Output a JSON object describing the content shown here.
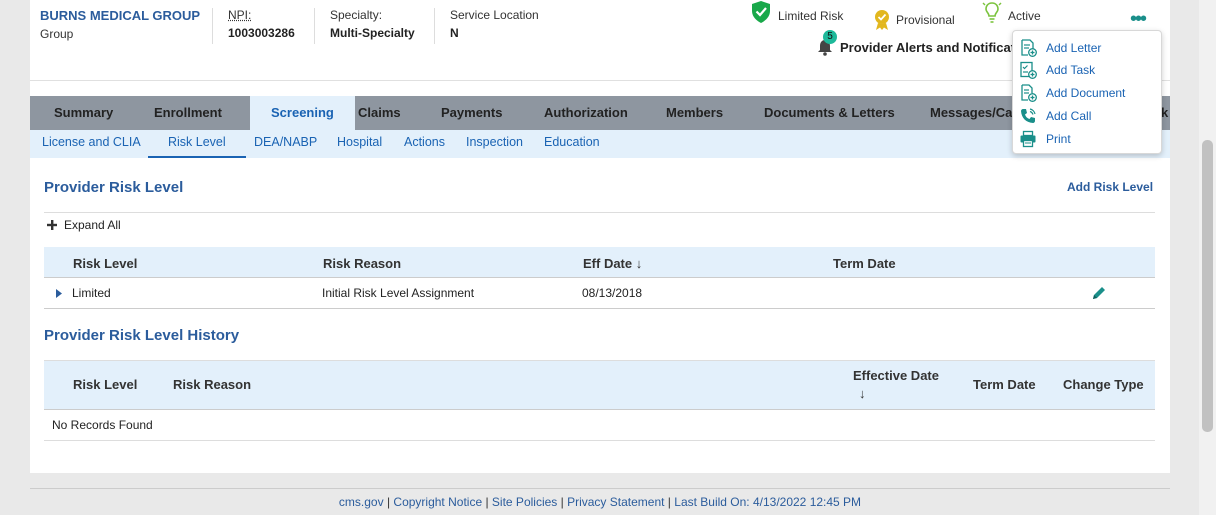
{
  "header": {
    "provider_name": "BURNS MEDICAL GROUP",
    "provider_type": "Group",
    "npi_label": "NPI:",
    "npi_value": "1003003286",
    "specialty_label": "Specialty:",
    "specialty_value": "Multi-Specialty",
    "service_location_label": "Service Location",
    "service_location_value": "N",
    "status_limited_risk": "Limited Risk",
    "status_provisional": "Provisional",
    "status_active": "Active",
    "alerts_count": "5",
    "alerts_label": "Provider Alerts and Notifications",
    "more_label": "•••"
  },
  "tabs": [
    {
      "label": "Summary"
    },
    {
      "label": "Enrollment"
    },
    {
      "label": "Screening"
    },
    {
      "label": "Claims"
    },
    {
      "label": "Payments"
    },
    {
      "label": "Authorization"
    },
    {
      "label": "Members"
    },
    {
      "label": "Documents & Letters"
    },
    {
      "label": "Messages/Calls"
    },
    {
      "label": "rk"
    }
  ],
  "subtabs": [
    {
      "label": "License and CLIA"
    },
    {
      "label": "Risk Level"
    },
    {
      "label": "DEA/NABP"
    },
    {
      "label": "Hospital"
    },
    {
      "label": "Actions"
    },
    {
      "label": "Inspection"
    },
    {
      "label": "Education"
    }
  ],
  "risk_level": {
    "title": "Provider Risk Level",
    "add_label": "Add Risk Level",
    "expand_all": "Expand All",
    "columns": [
      "Risk Level",
      "Risk Reason",
      "Eff Date ↓",
      "Term Date"
    ],
    "rows": [
      {
        "risk_level": "Limited",
        "risk_reason": "Initial Risk Level Assignment",
        "eff_date": "08/13/2018",
        "term_date": ""
      }
    ]
  },
  "history": {
    "title": "Provider Risk Level History",
    "columns": [
      "Risk Level",
      "Risk Reason",
      "Effective Date",
      "↓",
      "Term Date",
      "Change Type"
    ],
    "empty": "No Records Found"
  },
  "footer": {
    "links": [
      "cms.gov",
      "Copyright Notice",
      "Site Policies",
      "Privacy Statement"
    ],
    "build": "Last Build On: 4/13/2022 12:45 PM"
  },
  "menu": {
    "items": [
      {
        "label": "Add Letter",
        "icon": "add-letter-icon"
      },
      {
        "label": "Add Task",
        "icon": "add-task-icon"
      },
      {
        "label": "Add Document",
        "icon": "add-document-icon"
      },
      {
        "label": "Add Call",
        "icon": "add-call-icon"
      },
      {
        "label": "Print",
        "icon": "print-icon"
      }
    ]
  },
  "colors": {
    "accent": "#2b5c9c",
    "link": "#1a63b3",
    "menu_icon": "#1a8f8a",
    "tab_bar": "#8e96a0",
    "light_blue": "#e3f0fb"
  }
}
